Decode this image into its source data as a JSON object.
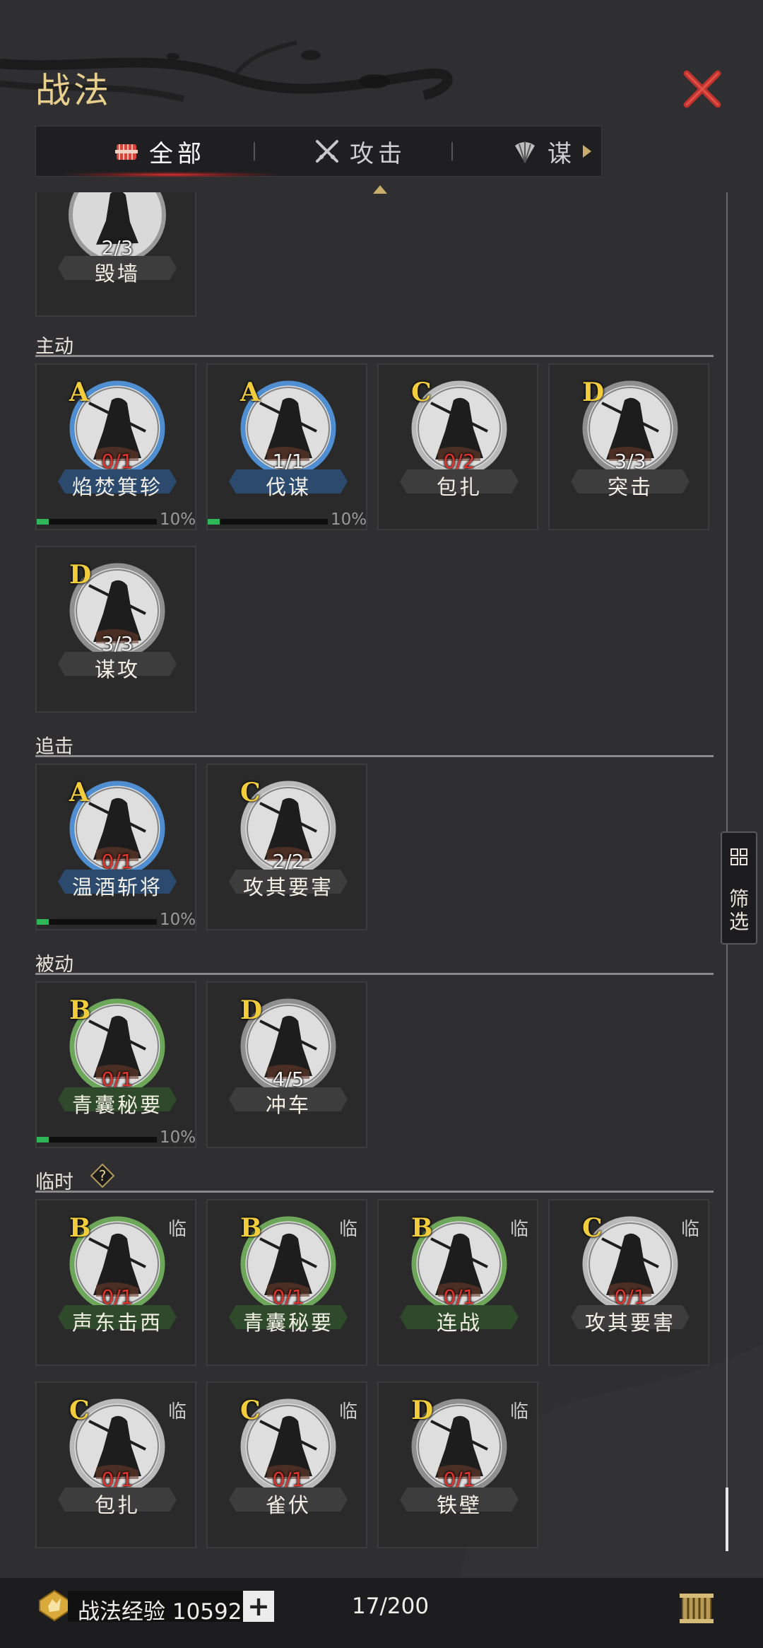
{
  "header": {
    "title": "战法"
  },
  "tabs": [
    {
      "label": "全部",
      "icon": "scroll-bundle-icon",
      "active": true
    },
    {
      "label": "攻击",
      "icon": "crossed-swords-icon",
      "active": false
    },
    {
      "label": "谋",
      "icon": "feather-fan-icon",
      "active": false
    }
  ],
  "filter": {
    "label": "筛选",
    "icon": "grid-icon"
  },
  "sections": [
    {
      "label": "主动"
    },
    {
      "label": "追击"
    },
    {
      "label": "被动"
    },
    {
      "label": "临时",
      "help_icon": "question-mark-icon"
    }
  ],
  "cards": {
    "top_partial": {
      "count": "2/3",
      "name": "毁墙"
    },
    "active": [
      {
        "grade": "A",
        "count": "0/1",
        "name": "焰焚箕轸",
        "progress": 0.1,
        "progress_label": "10%"
      },
      {
        "grade": "A",
        "count": "1/1",
        "name": "伐谋",
        "progress": 0.1,
        "progress_label": "10%"
      },
      {
        "grade": "C",
        "count": "0/2",
        "name": "包扎"
      },
      {
        "grade": "D",
        "count": "3/3",
        "name": "突击"
      },
      {
        "grade": "D",
        "count": "3/3",
        "name": "谋攻"
      }
    ],
    "pursuit": [
      {
        "grade": "A",
        "count": "0/1",
        "name": "温酒斩将",
        "progress": 0.1,
        "progress_label": "10%"
      },
      {
        "grade": "C",
        "count": "2/2",
        "name": "攻其要害"
      }
    ],
    "passive": [
      {
        "grade": "B",
        "count": "0/1",
        "name": "青囊秘要",
        "progress": 0.1,
        "progress_label": "10%"
      },
      {
        "grade": "D",
        "count": "4/5",
        "name": "冲车"
      }
    ],
    "temporary": [
      {
        "grade": "B",
        "count": "0/1",
        "name": "声东击西",
        "tag": "临"
      },
      {
        "grade": "B",
        "count": "0/1",
        "name": "青囊秘要",
        "tag": "临"
      },
      {
        "grade": "B",
        "count": "0/1",
        "name": "连战",
        "tag": "临"
      },
      {
        "grade": "C",
        "count": "0/1",
        "name": "攻其要害",
        "tag": "临"
      },
      {
        "grade": "C",
        "count": "0/1",
        "name": "包扎",
        "tag": "临"
      },
      {
        "grade": "C",
        "count": "0/1",
        "name": "雀伏",
        "tag": "临"
      },
      {
        "grade": "D",
        "count": "0/1",
        "name": "铁壁",
        "tag": "临"
      }
    ]
  },
  "footer": {
    "exp_label": "战法经验 10592",
    "plus": "+",
    "capacity": "17/200"
  },
  "colors": {
    "grade_A": "#4f8fd1",
    "grade_B": "#6da85a",
    "grade_C": "#b9b9b9",
    "grade_D": "#8f8f8f",
    "count_red": "#e0342f",
    "grade_letter": "#f1cc3d",
    "progress": "#2fb55a"
  }
}
